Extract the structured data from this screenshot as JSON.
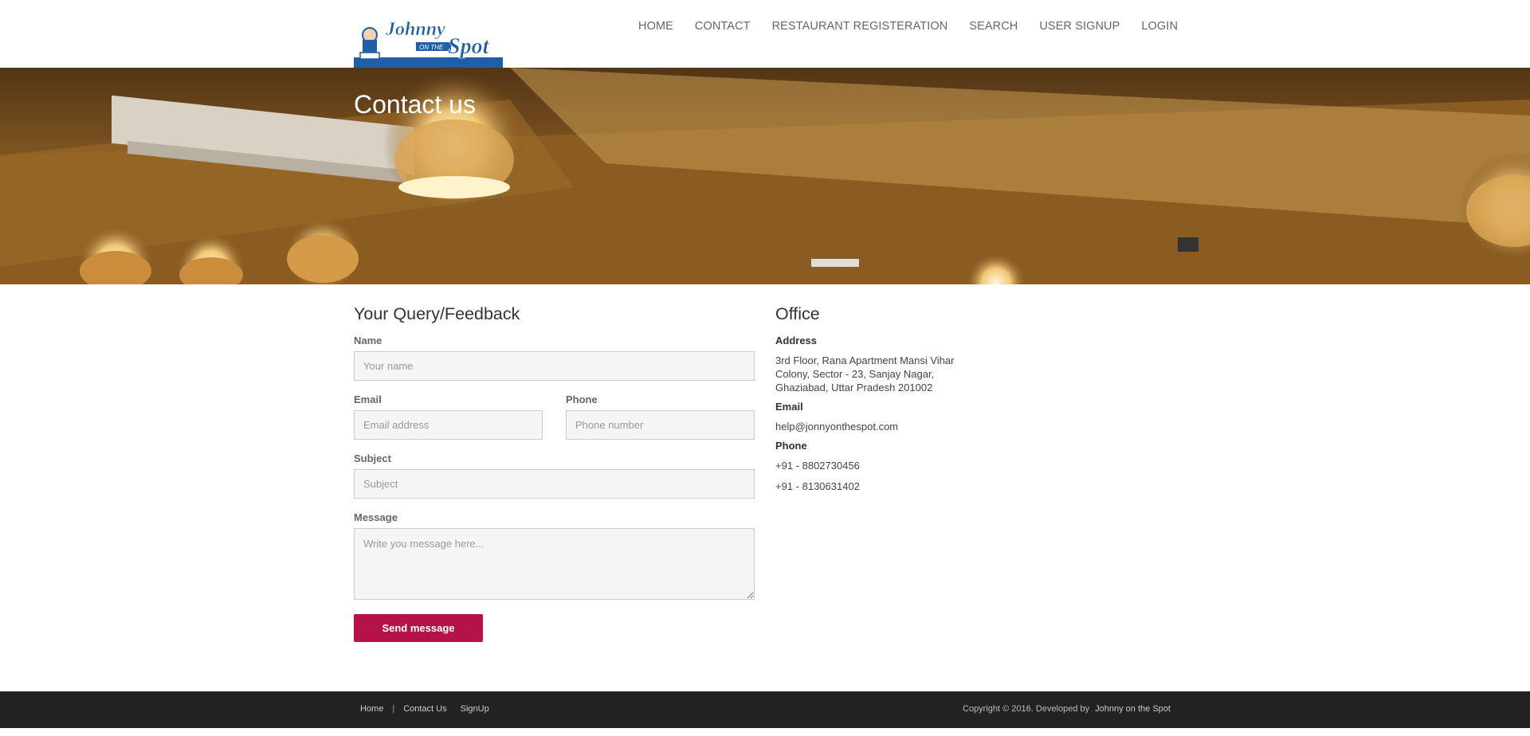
{
  "header": {
    "logo_text_1": "Johnny",
    "logo_text_2": "ON THE",
    "logo_text_3": "Spot",
    "nav": [
      "HOME",
      "CONTACT",
      "RESTAURANT REGISTERATION",
      "SEARCH",
      "USER SIGNUP",
      "LOGIN"
    ]
  },
  "hero": {
    "title": "Contact us"
  },
  "form": {
    "heading": "Your Query/Feedback",
    "name_label": "Name",
    "name_placeholder": "Your name",
    "email_label": "Email",
    "email_placeholder": "Email address",
    "phone_label": "Phone",
    "phone_placeholder": "Phone number",
    "subject_label": "Subject",
    "subject_placeholder": "Subject",
    "message_label": "Message",
    "message_placeholder": "Write you message here...",
    "submit_label": "Send message"
  },
  "office": {
    "heading": "Office",
    "address_label": "Address",
    "address": "3rd Floor, Rana Apartment Mansi Vihar Colony, Sector - 23, Sanjay Nagar, Ghaziabad, Uttar Pradesh 201002",
    "email_label": "Email",
    "email": "help@jonnyonthespot.com",
    "phone_label": "Phone",
    "phone_1": "+91 - 8802730456",
    "phone_2": "+91 - 8130631402"
  },
  "footer": {
    "links": [
      "Home",
      "Contact Us",
      "SignUp"
    ],
    "separator": "|",
    "copyright": "Copyright © 2016. Developed by",
    "brand": "Johnny on the Spot"
  },
  "colors": {
    "accent": "#b4134a",
    "footer_bg": "#222222",
    "logo_blue": "#1f5fa8"
  }
}
